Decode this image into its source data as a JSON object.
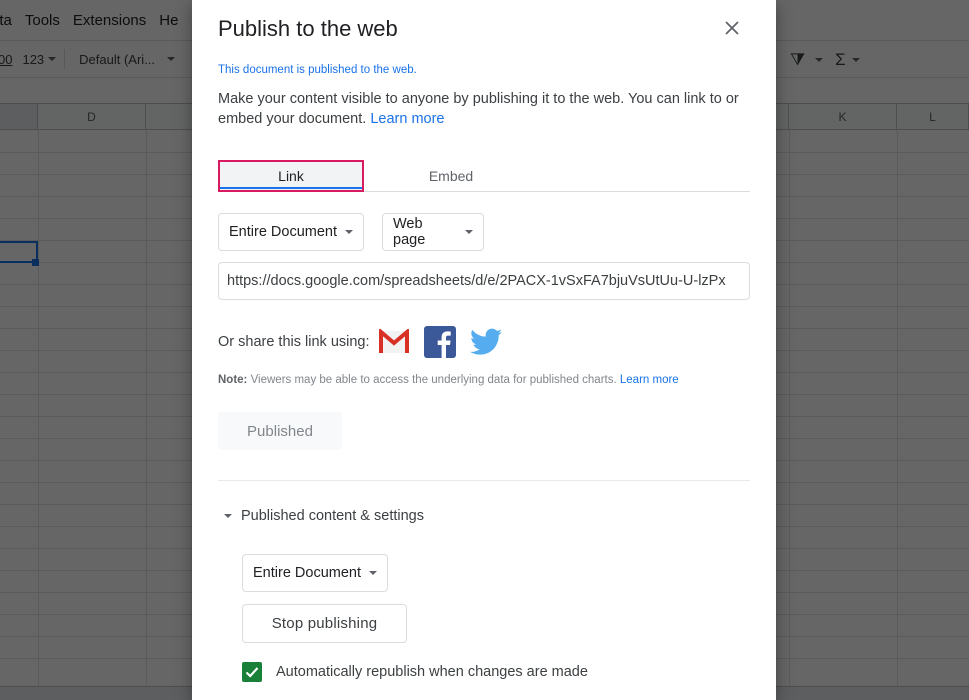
{
  "background": {
    "menu": [
      "ata",
      "Tools",
      "Extensions",
      "He"
    ],
    "toolbar": {
      "decimal_label": "00",
      "format_label": "123",
      "font_label": "Default (Ari..."
    },
    "columns": [
      "",
      "D",
      "",
      "K",
      "L"
    ]
  },
  "dialog": {
    "title": "Publish to the web",
    "close_icon": "close-icon",
    "status_message": "This document is published to the web.",
    "description": "Make your content visible to anyone by publishing it to the web. You can link to or embed your document.",
    "description_link": "Learn more",
    "tabs": [
      {
        "label": "Link",
        "active": true
      },
      {
        "label": "Embed",
        "active": false
      }
    ],
    "scope_select": "Entire Document",
    "format_select": "Web page",
    "url": "https://docs.google.com/spreadsheets/d/e/2PACX-1vSxFA7bjuVsUtUu-U-lzPx",
    "share_label": "Or share this link using:",
    "share_icons": [
      "gmail-icon",
      "facebook-icon",
      "twitter-icon"
    ],
    "note_label": "Note:",
    "note_text": "Viewers may be able to access the underlying data for published charts.",
    "note_link": "Learn more",
    "published_button": "Published",
    "settings_section": {
      "label": "Published content & settings",
      "expanded": true,
      "scope_select": "Entire Document",
      "stop_button": "Stop publishing",
      "auto_republish_label": "Automatically republish when changes are made",
      "auto_republish_checked": true
    }
  },
  "colors": {
    "accent_blue": "#1a73e8",
    "tab_focus_outline": "#d81b60",
    "checkbox_green": "#188038",
    "gmail_red": "#d93025",
    "facebook_blue": "#3b5998",
    "twitter_blue": "#55acee"
  }
}
